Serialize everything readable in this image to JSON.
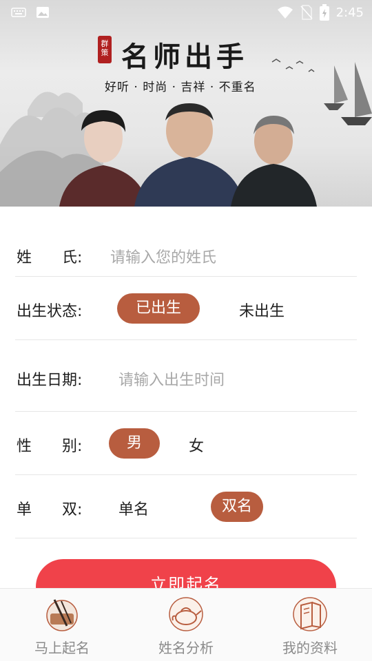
{
  "status_bar": {
    "time": "2:45",
    "icons": [
      "keyboard-icon",
      "image-icon",
      "wifi-icon",
      "no-sim-icon",
      "battery-icon"
    ]
  },
  "banner": {
    "seal_text": "群策",
    "title": "名师出手",
    "subtitle": "好听 · 时尚 · 吉祥 · 不重名"
  },
  "form": {
    "surname": {
      "label": "姓　　氏:",
      "placeholder": "请输入您的姓氏"
    },
    "birth_status": {
      "label": "出生状态:",
      "options": [
        "已出生",
        "未出生"
      ],
      "selected": "已出生"
    },
    "birth_date": {
      "label": "出生日期:",
      "placeholder": "请输入出生时间"
    },
    "gender": {
      "label": "性　　别:",
      "options": [
        "男",
        "女"
      ],
      "selected": "男"
    },
    "name_length": {
      "label": "单　　双:",
      "options": [
        "单名",
        "双名"
      ],
      "selected": "双名"
    }
  },
  "submit_label": "立即起名",
  "colors": {
    "accent": "#b85d3f",
    "submit": "#f0424a"
  },
  "bottom_nav": {
    "items": [
      {
        "label": "马上起名",
        "icon": "brush-ink-icon"
      },
      {
        "label": "姓名分析",
        "icon": "teapot-icon"
      },
      {
        "label": "我的资料",
        "icon": "book-scroll-icon"
      }
    ]
  }
}
